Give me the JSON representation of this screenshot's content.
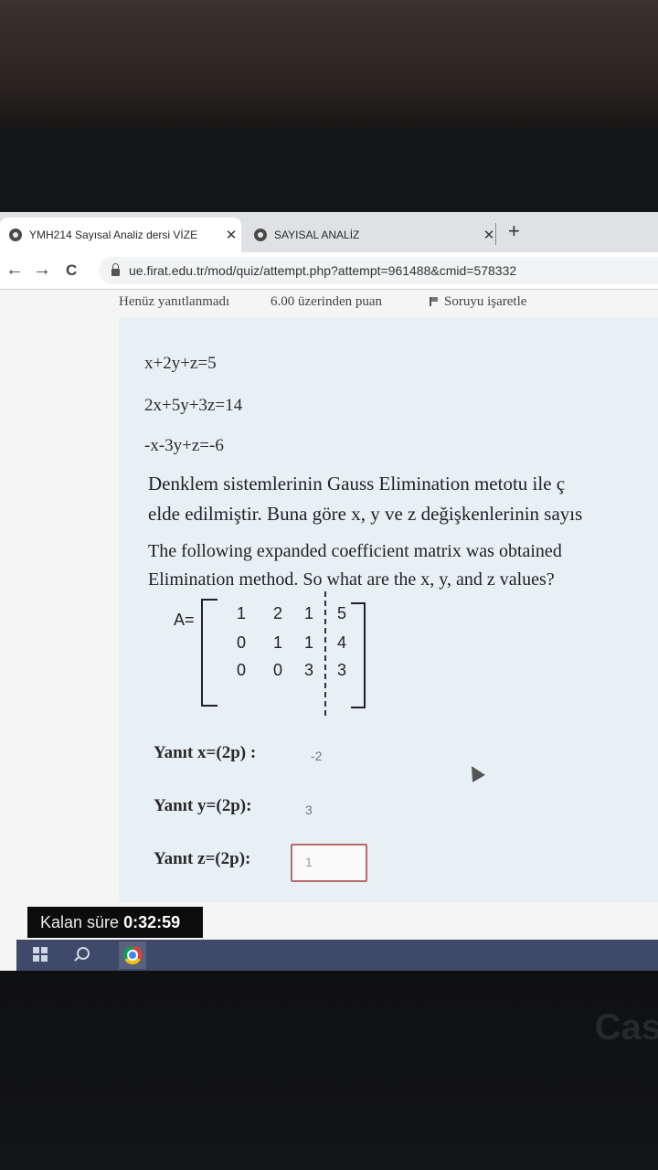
{
  "browser": {
    "tabs": [
      {
        "title": "YMH214 Sayısal Analiz dersi VİZE",
        "close": "✕",
        "active": true
      },
      {
        "title": "SAYISAL ANALİZ",
        "close": "✕",
        "active": false
      }
    ],
    "new_tab": "+",
    "url": "ue.firat.edu.tr/mod/quiz/attempt.php?attempt=961488&cmid=578332",
    "nav": {
      "back": "←",
      "forward": "→",
      "reload": "C"
    }
  },
  "question": {
    "status": "Henüz yanıtlanmadı",
    "points": "6.00 üzerinden puan",
    "flag_label": "Soruyu işaretle",
    "equations": [
      "x+2y+z=5",
      "2x+5y+3z=14",
      "-x-3y+z=-6"
    ],
    "text_tr": [
      "Denklem sistemlerinin Gauss Elimination metotu ile ç",
      "elde edilmiştir. Buna göre x, y ve z değişkenlerinin sayıs"
    ],
    "text_en": [
      "The following expanded coefficient matrix was obtained",
      "Elimination method. So what are the x, y, and z values?"
    ],
    "matrix": {
      "label": "A=",
      "rows": [
        [
          "1",
          "2",
          "1",
          "5"
        ],
        [
          "0",
          "1",
          "1",
          "4"
        ],
        [
          "0",
          "0",
          "3",
          "3"
        ]
      ]
    },
    "answers": [
      {
        "label": "Yanıt x=(2p) :",
        "value": "-2"
      },
      {
        "label": "Yanıt y=(2p):",
        "value": "3"
      },
      {
        "label": "Yanıt z=(2p):",
        "value": "1"
      }
    ]
  },
  "timer": {
    "label": "Kalan süre",
    "value": "0:32:59"
  },
  "brand": "Cas"
}
